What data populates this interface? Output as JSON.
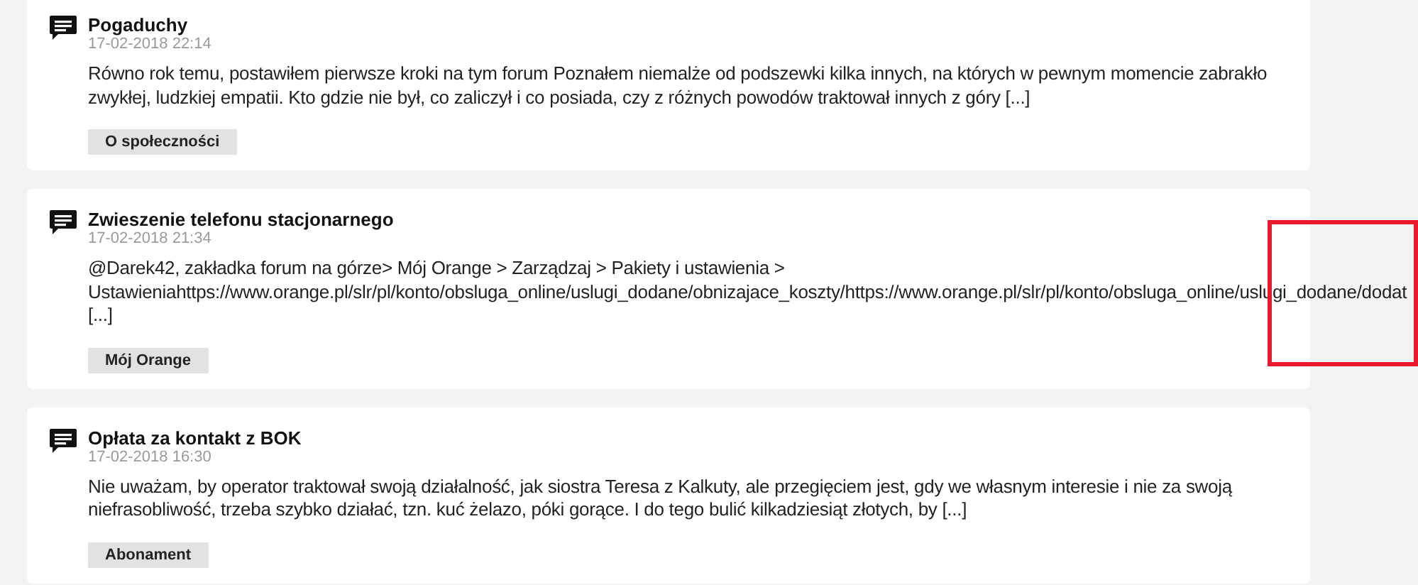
{
  "posts": [
    {
      "title": "Pogaduchy",
      "date": "17-02-2018 22:14",
      "body": "Równo rok temu, postawiłem pierwsze kroki na tym forum Poznałem niemalże od podszewki kilka innych, na których w pewnym momencie zabrakło\nzwykłej, ludzkiej empatii. Kto gdzie nie był, co zaliczył i co posiada, czy z różnych powodów traktował innych z góry [...]",
      "tag": "O społeczności"
    },
    {
      "title": "Zwieszenie telefonu stacjonarnego",
      "date": "17-02-2018 21:34",
      "body": "@Darek42, zakładka forum na górze> Mój Orange > Zarządzaj > Pakiety i ustawienia >\nUstawieniahttps://www.orange.pl/slr/pl/konto/obsluga_online/uslugi_dodane/obnizajace_koszty/https://www.orange.pl/slr/pl/konto/obsluga_online/uslugi_dodane/dodat\n[...]",
      "tag": "Mój Orange"
    },
    {
      "title": "Opłata za kontakt z BOK",
      "date": "17-02-2018 16:30",
      "body": "Nie uważam, by operator traktował swoją działalność, jak siostra Teresa z Kalkuty, ale przegięciem jest, gdy we własnym interesie i nie za swoją\nniefrasobliwość, trzeba szybko działać, tzn. kuć żelazo, póki gorące. I do tego bulić kilkadziesiąt złotych, by [...]",
      "tag": "Abonament"
    }
  ]
}
